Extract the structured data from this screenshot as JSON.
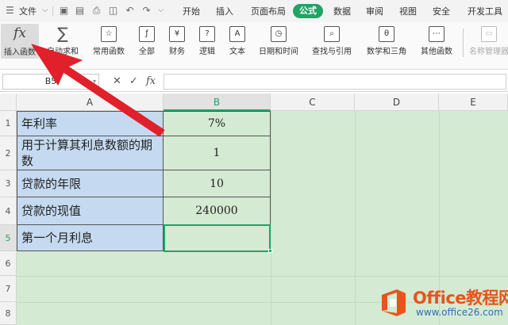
{
  "menubar": {
    "file_label": "文件",
    "tabs": [
      "开始",
      "插入",
      "页面布局",
      "公式",
      "数据",
      "审阅",
      "视图",
      "安全",
      "开发工具"
    ],
    "active_tab": "公式"
  },
  "ribbon": {
    "insert_function": "插入函数",
    "autosum": "自动求和",
    "common_functions": "常用函数",
    "all": "全部",
    "finance": "财务",
    "logic": "逻辑",
    "text": "文本",
    "datetime": "日期和时间",
    "lookup": "查找与引用",
    "math": "数学和三角",
    "other": "其他函数",
    "name_manager": "名称管理器",
    "fx_symbol": "fx",
    "sigma_symbol": "∑"
  },
  "formula_bar": {
    "name_box": "B5",
    "cancel_symbol": "✕",
    "confirm_symbol": "✓",
    "fx_symbol": "fx",
    "value": ""
  },
  "grid": {
    "columns": [
      "A",
      "B",
      "C",
      "D",
      "E"
    ],
    "selected_column": "B",
    "row_numbers": [
      "1",
      "2",
      "3",
      "4",
      "5",
      "6",
      "7",
      "8"
    ],
    "selected_row": "5",
    "rows": [
      {
        "label": "年利率",
        "value": "7%"
      },
      {
        "label": "用于计算其利息数额的期数",
        "value": "1"
      },
      {
        "label": "贷款的年限",
        "value": "10"
      },
      {
        "label": "贷款的现值",
        "value": "240000"
      },
      {
        "label": "第一个月利息",
        "value": ""
      }
    ]
  },
  "watermark": {
    "title": "Office教程网",
    "url": "www.office26.com"
  },
  "colors": {
    "accent": "#21a366",
    "label_cell_bg": "#c5daf0",
    "sheet_bg": "#d4ead2",
    "arrow": "#e0202a",
    "watermark_orange": "#e8541c",
    "watermark_blue": "#2f6fb8"
  }
}
